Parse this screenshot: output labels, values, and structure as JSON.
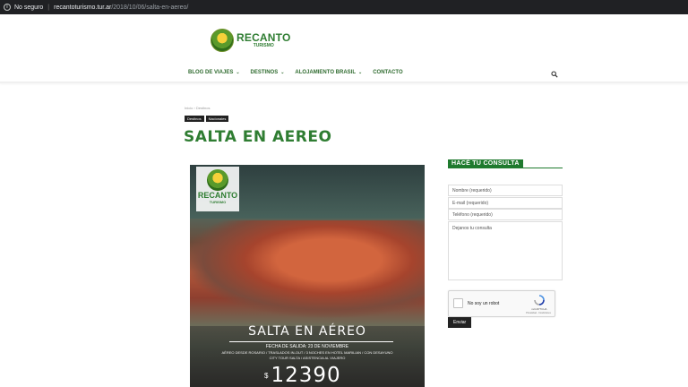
{
  "browser": {
    "security_label": "No seguro",
    "url_domain": "recantoturismo.tur.ar",
    "url_path": "/2018/10/06/salta-en-aereo/"
  },
  "header": {
    "brand": "RECANTO",
    "brand_sub": "TURISMO",
    "nav": [
      {
        "label": "BLOG DE VIAJES",
        "has_dropdown": true
      },
      {
        "label": "DESTINOS",
        "has_dropdown": true
      },
      {
        "label": "ALOJAMIENTO BRASIL",
        "has_dropdown": true
      },
      {
        "label": "CONTACTO",
        "has_dropdown": false
      }
    ],
    "search_icon": "search-icon"
  },
  "article": {
    "breadcrumb": [
      "Inicio",
      "Destinos"
    ],
    "tags": [
      "Destinos",
      "Nacionales"
    ],
    "title": "SALTA EN AEREO",
    "hero": {
      "logo_brand": "RECANTO",
      "logo_sub": "TURISMO",
      "title": "SALTA EN AÉREO",
      "date_line": "FECHA DE SALIDA: 23 DE NOVIEMBRE",
      "desc_line1": "AÉREO DESDE ROSARIO / TRASLADOS IN-OUT / 3 NOCHES EN HOTEL MARILIAN / CON DESAYUNO",
      "desc_line2": "CITY TOUR SALTA / ASISTENCIA AL VIAJERO",
      "currency": "$",
      "price": "12390"
    }
  },
  "sidebar": {
    "title": "HACÉ TU CONSULTA",
    "name_placeholder": "Nombre (requerido)",
    "email_placeholder": "E-mail (requerido)",
    "phone_placeholder": "Teléfono (requerido)",
    "message_placeholder": "Dejanos tu consulta",
    "captcha_label": "No soy un robot",
    "captcha_brand": "reCAPTCHA",
    "captcha_terms": "Privacidad - Condiciones",
    "submit_label": "Enviar"
  },
  "colors": {
    "brand_green": "#2f7d32",
    "sidebar_green": "#1f7a2e",
    "browser_bar": "#202124"
  }
}
